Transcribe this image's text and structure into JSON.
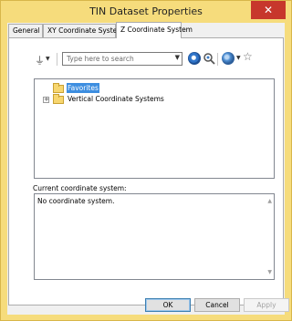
{
  "window": {
    "title": "TIN Dataset Properties",
    "close_symbol": "✕"
  },
  "tabs": [
    {
      "label": "General"
    },
    {
      "label": "XY Coordinate System"
    },
    {
      "label": "Z Coordinate System"
    }
  ],
  "toolbar": {
    "search_placeholder": "Type here to search"
  },
  "tree": {
    "items": [
      {
        "label": "Favorites",
        "selected": true
      },
      {
        "label": "Vertical Coordinate Systems",
        "expandable": true
      }
    ]
  },
  "current": {
    "label": "Current coordinate system:",
    "value": "No coordinate system."
  },
  "buttons": {
    "ok": "OK",
    "cancel": "Cancel",
    "apply": "Apply"
  },
  "colors": {
    "accent": "#f6dc7c",
    "close": "#c7372c",
    "selection": "#3d8ee0"
  }
}
